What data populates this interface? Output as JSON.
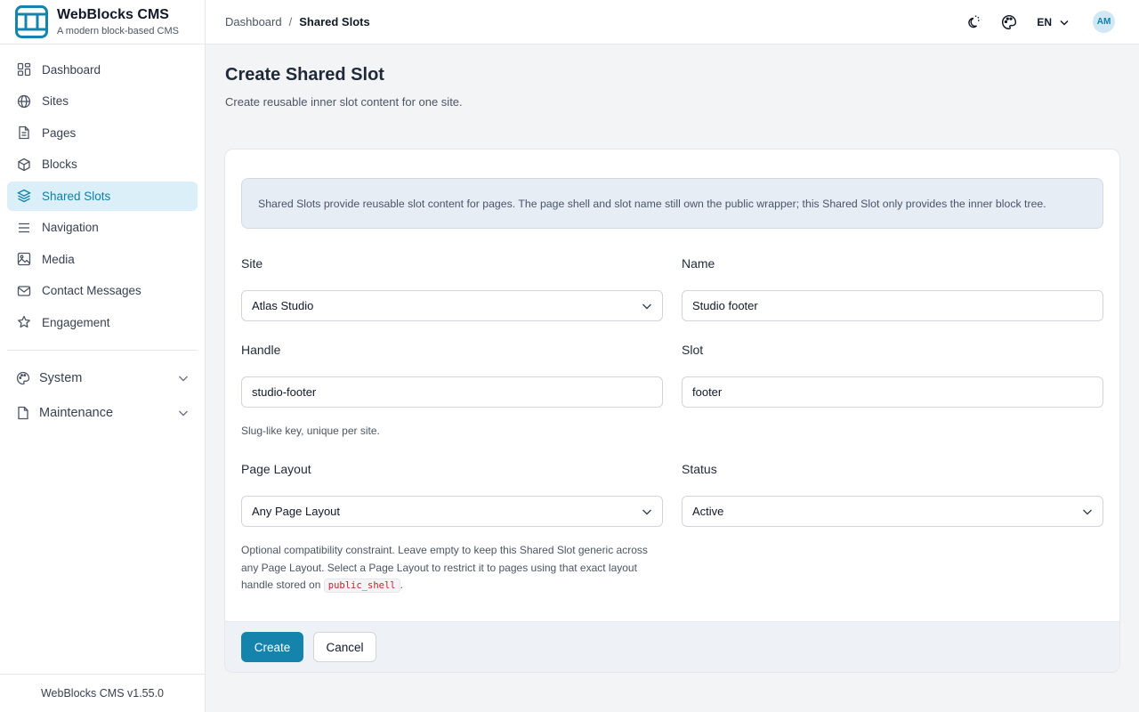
{
  "brand": {
    "title": "WebBlocks CMS",
    "subtitle": "A modern block-based CMS",
    "accent": "#1584ad"
  },
  "sidebar": {
    "items": [
      {
        "label": "Dashboard",
        "icon": "dashboard-icon"
      },
      {
        "label": "Sites",
        "icon": "globe-icon"
      },
      {
        "label": "Pages",
        "icon": "document-icon"
      },
      {
        "label": "Blocks",
        "icon": "cube-icon"
      },
      {
        "label": "Shared Slots",
        "icon": "layers-icon",
        "active": true
      },
      {
        "label": "Navigation",
        "icon": "menu-icon"
      },
      {
        "label": "Media",
        "icon": "image-icon"
      },
      {
        "label": "Contact Messages",
        "icon": "mail-icon"
      },
      {
        "label": "Engagement",
        "icon": "star-icon"
      }
    ],
    "groups": [
      {
        "label": "System",
        "icon": "palette-icon"
      },
      {
        "label": "Maintenance",
        "icon": "file-icon"
      }
    ],
    "footer": "WebBlocks CMS v1.55.0"
  },
  "topbar": {
    "breadcrumb_parent": "Dashboard",
    "breadcrumb_sep": "/",
    "breadcrumb_current": "Shared Slots",
    "language": "EN",
    "avatar_initials": "AM"
  },
  "page": {
    "title": "Create Shared Slot",
    "subtitle": "Create reusable inner slot content for one site."
  },
  "form": {
    "notice": "Shared Slots provide reusable slot content for pages. The page shell and slot name still own the public wrapper; this Shared Slot only provides the inner block tree.",
    "site": {
      "label": "Site",
      "value": "Atlas Studio"
    },
    "name": {
      "label": "Name",
      "value": "Studio footer"
    },
    "handle": {
      "label": "Handle",
      "value": "studio-footer",
      "help": "Slug-like key, unique per site."
    },
    "slot": {
      "label": "Slot",
      "value": "footer"
    },
    "page_layout": {
      "label": "Page Layout",
      "value": "Any Page Layout",
      "help_before": "Optional compatibility constraint. Leave empty to keep this Shared Slot generic across any Page Layout. Select a Page Layout to restrict it to pages using that exact layout handle stored on ",
      "help_code": "public_shell",
      "help_after": "."
    },
    "status": {
      "label": "Status",
      "value": "Active"
    },
    "create_label": "Create",
    "cancel_label": "Cancel"
  }
}
